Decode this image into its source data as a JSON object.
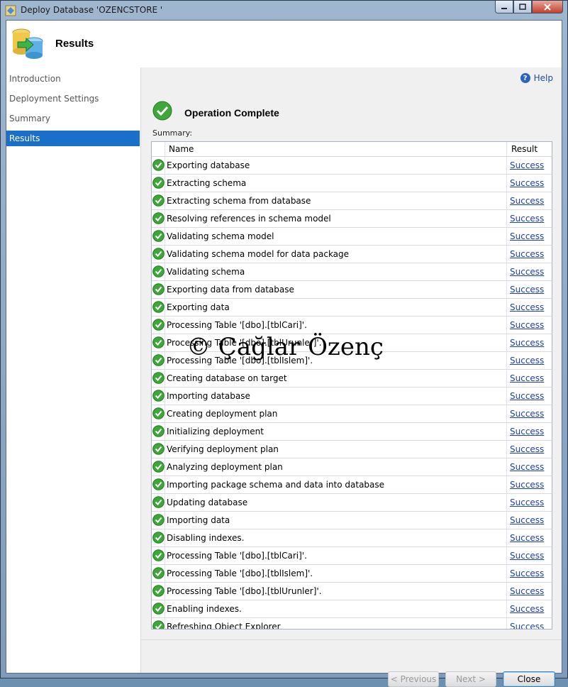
{
  "window": {
    "title": "Deploy Database 'OZENCSTORE '"
  },
  "header": {
    "title": "Results"
  },
  "nav": {
    "items": [
      {
        "label": "Introduction",
        "active": false
      },
      {
        "label": "Deployment Settings",
        "active": false
      },
      {
        "label": "Summary",
        "active": false
      },
      {
        "label": "Results",
        "active": true
      }
    ]
  },
  "help": {
    "label": "Help"
  },
  "operation": {
    "title": "Operation Complete"
  },
  "summary": {
    "label": "Summary:",
    "columns": {
      "name": "Name",
      "result": "Result"
    },
    "rows": [
      {
        "name": "Exporting database",
        "result": "Success"
      },
      {
        "name": "Extracting schema",
        "result": "Success"
      },
      {
        "name": "Extracting schema from database",
        "result": "Success"
      },
      {
        "name": "Resolving references in schema model",
        "result": "Success"
      },
      {
        "name": "Validating schema model",
        "result": "Success"
      },
      {
        "name": "Validating schema model for data package",
        "result": "Success"
      },
      {
        "name": "Validating schema",
        "result": "Success"
      },
      {
        "name": "Exporting data from database",
        "result": "Success"
      },
      {
        "name": "Exporting data",
        "result": "Success"
      },
      {
        "name": "Processing Table '[dbo].[tblCari]'.",
        "result": "Success"
      },
      {
        "name": "Processing Table '[dbo].[tblUrunler]'.",
        "result": "Success"
      },
      {
        "name": "Processing Table '[dbo].[tblIslem]'.",
        "result": "Success"
      },
      {
        "name": "Creating database on target",
        "result": "Success"
      },
      {
        "name": "Importing database",
        "result": "Success"
      },
      {
        "name": "Creating deployment plan",
        "result": "Success"
      },
      {
        "name": "Initializing deployment",
        "result": "Success"
      },
      {
        "name": "Verifying deployment plan",
        "result": "Success"
      },
      {
        "name": "Analyzing deployment plan",
        "result": "Success"
      },
      {
        "name": "Importing package schema and data into database",
        "result": "Success"
      },
      {
        "name": "Updating database",
        "result": "Success"
      },
      {
        "name": "Importing data",
        "result": "Success"
      },
      {
        "name": "Disabling indexes.",
        "result": "Success"
      },
      {
        "name": "Processing Table '[dbo].[tblCari]'.",
        "result": "Success"
      },
      {
        "name": "Processing Table '[dbo].[tblIslem]'.",
        "result": "Success"
      },
      {
        "name": "Processing Table '[dbo].[tblUrunler]'.",
        "result": "Success"
      },
      {
        "name": "Enabling indexes.",
        "result": "Success"
      },
      {
        "name": "Refreshing Object Explorer",
        "result": "Success"
      }
    ]
  },
  "watermark": "© Çağlar Özenç",
  "buttons": {
    "previous": "< Previous",
    "next": "Next >",
    "close": "Close"
  }
}
